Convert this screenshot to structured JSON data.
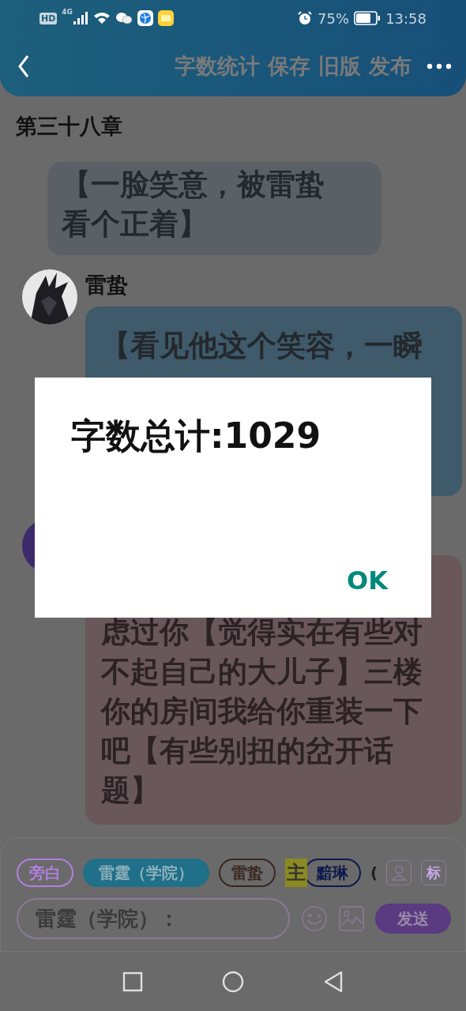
{
  "status_bar": {
    "badges": [
      "HD",
      "4G"
    ],
    "battery": "75%",
    "time": "13:58"
  },
  "header": {
    "actions": [
      "字数统计",
      "保存",
      "旧版",
      "发布"
    ]
  },
  "chapter_title": "第三十八章",
  "messages": [
    {
      "kind": "plain",
      "color": "#5b6066",
      "text": "【一脸笑意，被雷蛰看个正着】"
    },
    {
      "kind": "speaker",
      "name": "雷蛰",
      "color": "#3f5a6a",
      "text": "【看见他这个笑容，一瞬"
    },
    {
      "kind": "speaker",
      "color": "#69575b",
      "text": "虑过你【觉得实在有些对不起自己的大儿子】三楼你的房间我给你重装一下吧【有些别扭的岔开话题】"
    }
  ],
  "composer": {
    "chips": [
      {
        "label": "旁白",
        "color": "#b27fe0",
        "selected": false
      },
      {
        "label": "雷霆（学院）",
        "color": "#1f7088",
        "selected": true
      },
      {
        "label": "雷蛰",
        "color": "#3a2820",
        "selected": false
      },
      {
        "label": "黯琳",
        "color": "#0c1a4c",
        "selected": false,
        "badge": "主"
      },
      {
        "label": "(",
        "color": "#1e1e1e",
        "selected": false
      }
    ],
    "tag_button": "标",
    "placeholder": "雷霆（学院）：",
    "send": "发送"
  },
  "dialog": {
    "title": "字数总计:1029",
    "button": "OK"
  }
}
